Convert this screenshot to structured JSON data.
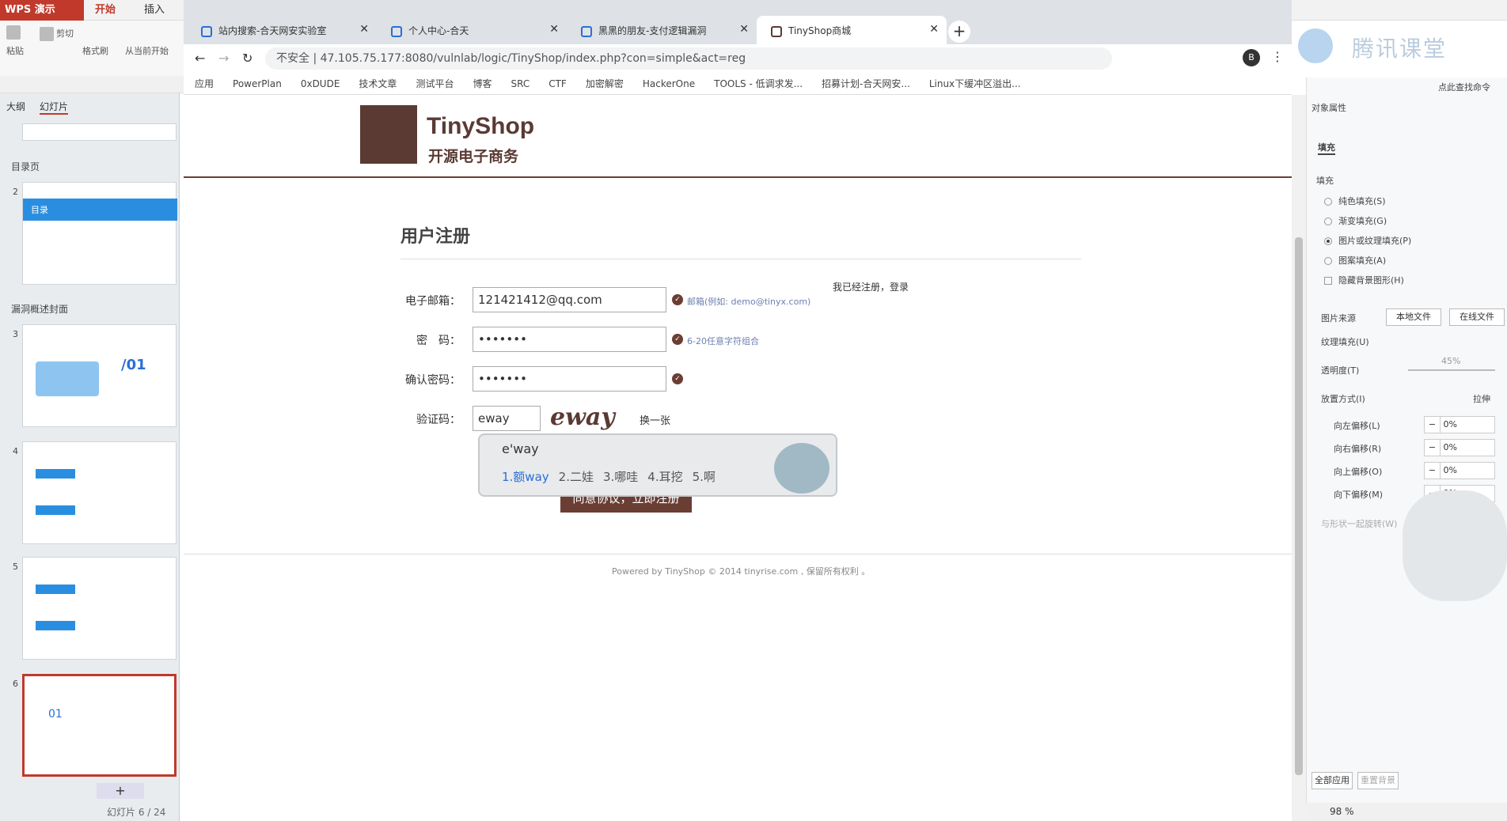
{
  "wps": {
    "logo": "WPS 演示",
    "tabs": [
      "开始",
      "插入"
    ],
    "ribbon": {
      "paste": "粘贴",
      "cut": "剪切",
      "format_painter": "格式刷",
      "from_start": "从当前开始"
    },
    "panel_tabs": [
      "大纲",
      "幻灯片"
    ],
    "sections": {
      "toc": "目录页",
      "cover": "漏洞概述封面"
    },
    "slides": [
      {
        "num": "2",
        "title": "目录"
      },
      {
        "num": "3",
        "title": "/01"
      },
      {
        "num": "4",
        "title": ""
      },
      {
        "num": "5",
        "title": ""
      },
      {
        "num": "6",
        "title": "01"
      }
    ],
    "slide_count": "幻灯片 6 / 24",
    "add_slide": "+"
  },
  "browser": {
    "tabs": [
      {
        "title": "站内搜索-合天网安实验室"
      },
      {
        "title": "个人中心-合天"
      },
      {
        "title": "黑黑的朋友-支付逻辑漏洞"
      },
      {
        "title": "TinyShop商城"
      }
    ],
    "new_tab": "+",
    "url": "不安全 | 47.105.75.177:8080/vulnlab/logic/TinyShop/index.php?con=simple&act=reg",
    "profile": "B",
    "bookmarks": [
      "应用",
      "PowerPlan",
      "0xDUDE",
      "技术文章",
      "测试平台",
      "博客",
      "SRC",
      "CTF",
      "加密解密",
      "HackerOne",
      "TOOLS - 低调求发...",
      "招募计划-合天网安...",
      "Linux下缓冲区溢出..."
    ]
  },
  "page": {
    "logo_text": "TinyShop",
    "logo_sub": "开源电子商务",
    "title": "用户注册",
    "login_link": "我已经注册，登录",
    "form": {
      "email_label": "电子邮箱：",
      "email_value": "121421412@qq.com",
      "email_hint": "邮箱(例如: demo@tinyx.com)",
      "password_label": "密　码：",
      "password_value": "•••••••",
      "password_hint": "6-20任意字符组合",
      "confirm_label": "确认密码：",
      "confirm_value": "•••••••",
      "captcha_label": "验证码：",
      "captcha_value": "eway",
      "captcha_image_text": "eway",
      "refresh": "换一张",
      "submit": "同意协议，立即注册"
    },
    "footer": "Powered by TinyShop © 2014 tinyrise.com , 保留所有权利 。"
  },
  "ime": {
    "input": "e'way",
    "candidates": [
      "1.额way",
      "2.二娃",
      "3.哪哇",
      "4.耳挖",
      "5.啊"
    ]
  },
  "tencent": {
    "text": "腾讯课堂"
  },
  "right_panel": {
    "search": "点此查找命令",
    "object_props": "对象属性",
    "fill_tab": "填充",
    "fill_section": "填充",
    "options": [
      "纯色填充(S)",
      "渐变填充(G)",
      "图片或纹理填充(P)",
      "图案填充(A)",
      "隐藏背景图形(H)"
    ],
    "picture_source": "图片来源",
    "local_file": "本地文件",
    "online_file": "在线文件",
    "texture_fill": "纹理填充(U)",
    "transparency": "透明度(T)",
    "transparency_value": "45%",
    "placement": "放置方式(I)",
    "placement_value": "拉伸",
    "offsets": [
      {
        "label": "向左偏移(L)",
        "value": "0%"
      },
      {
        "label": "向右偏移(R)",
        "value": "0%"
      },
      {
        "label": "向上偏移(O)",
        "value": "0%"
      },
      {
        "label": "向下偏移(M)",
        "value": "0%"
      }
    ],
    "rotate_with_shape": "与形状一起旋转(W)",
    "apply_all": "全部应用",
    "reset_bg": "重置背景",
    "zoom": "98 %"
  }
}
